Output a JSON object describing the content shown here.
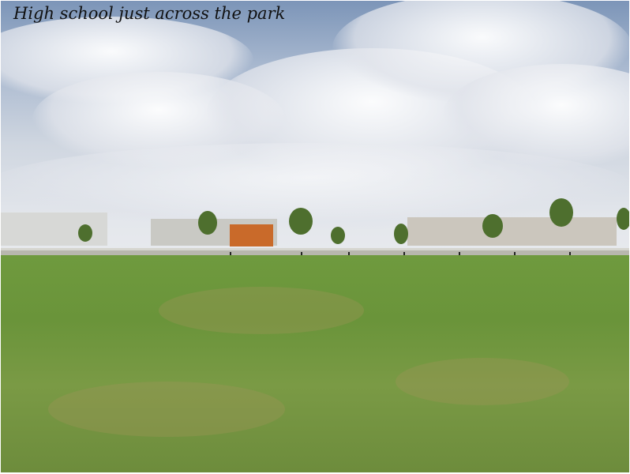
{
  "photo": {
    "caption": "High school just across the park",
    "colors": {
      "sky_top": "#7c95b8",
      "cloud": "#e4e7ec",
      "grass": "#6f9a3e",
      "caption_text": "#111111"
    }
  }
}
